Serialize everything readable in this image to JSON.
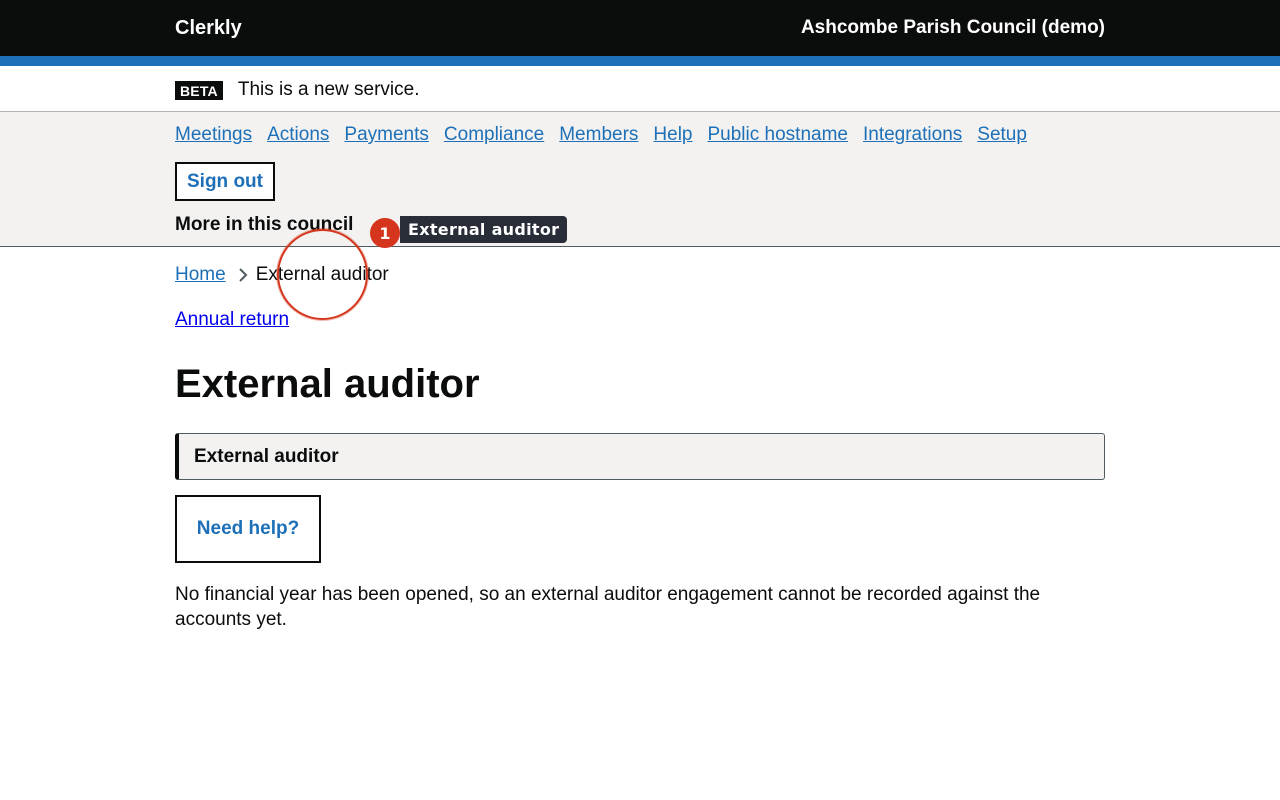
{
  "header": {
    "logo": "Clerkly",
    "council": "Ashcombe Parish Council (demo)"
  },
  "phase_banner": {
    "tag": "BETA",
    "text": "This is a new service."
  },
  "nav": {
    "items": [
      "Meetings",
      "Actions",
      "Payments",
      "Compliance",
      "Members",
      "Help",
      "Public hostname",
      "Integrations",
      "Setup"
    ],
    "sign_out": "Sign out",
    "more_label": "More in this council"
  },
  "breadcrumb": {
    "home": "Home",
    "current": "External auditor"
  },
  "annual_return_link": "Annual return",
  "page_title": "External auditor",
  "panel_text": "External auditor",
  "help_button": "Need help?",
  "body_text": "No financial year has been opened, so an external auditor engagement cannot be recorded against the accounts yet.",
  "annotation": {
    "badge": "1",
    "label": "External auditor"
  },
  "colors": {
    "header_bg": "#0b0c0c",
    "accent_blue": "#1d70b8",
    "annotation_red": "#d4351c"
  }
}
